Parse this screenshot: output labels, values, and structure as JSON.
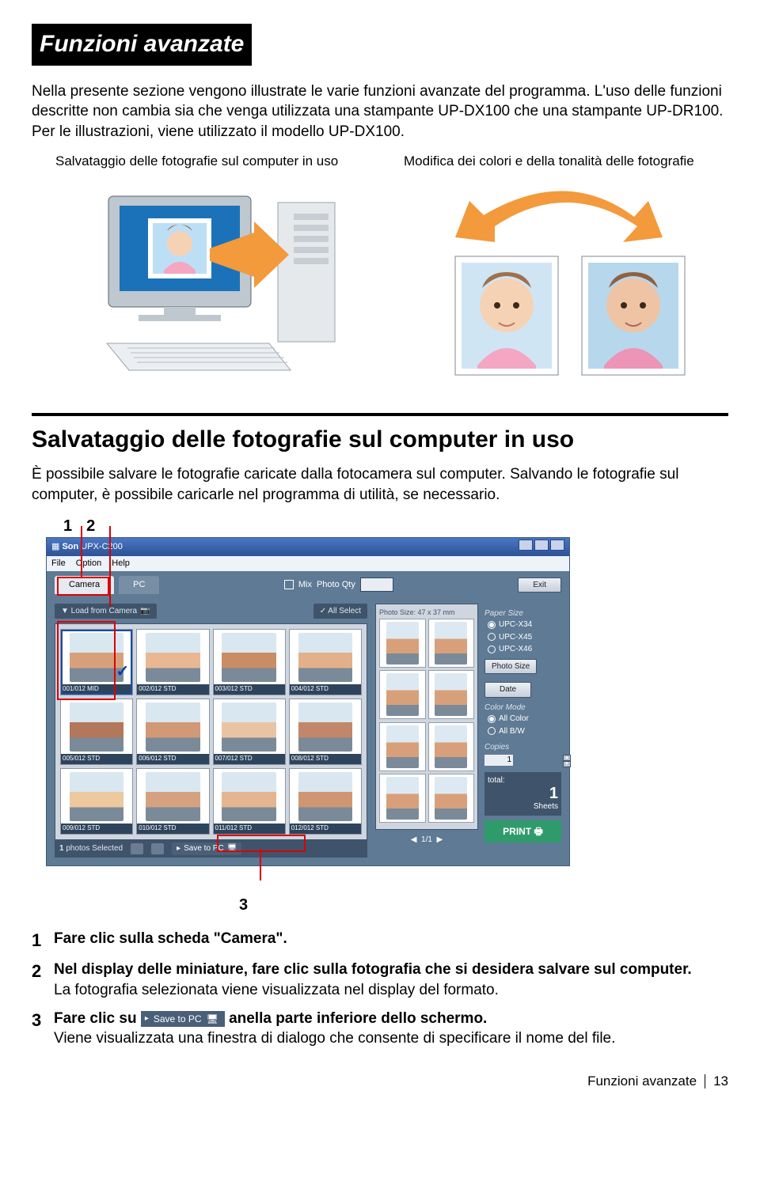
{
  "section_title": "Funzioni avanzate",
  "intro": "Nella presente sezione vengono illustrate le varie funzioni avanzate del programma. L'uso delle funzioni descritte non cambia sia che venga utilizzata una stampante UP-DX100 che una stampante UP-DR100. Per le illustrazioni, viene utilizzato il modello UP-DX100.",
  "col_left_caption": "Salvataggio delle fotografie sul computer in uso",
  "col_right_caption": "Modifica dei colori e della tonalità delle fotografie",
  "h2": "Salvataggio delle fotografie sul computer in uso",
  "body": "È possibile salvare le fotografie caricate dalla fotocamera sul computer. Salvando le fotografie sul computer, è possibile caricarle nel programma di utilità, se necessario.",
  "callouts": {
    "one": "1",
    "two": "2",
    "three": "3"
  },
  "app": {
    "title_prefix": "Son",
    "title_model": "UPX-C200",
    "menu": {
      "file": "File",
      "option": "Option",
      "help": "Help"
    },
    "tabs": {
      "camera": "Camera",
      "pc": "PC"
    },
    "mix_label": "Mix",
    "photo_qty_label": "Photo Qty",
    "exit": "Exit",
    "load_btn": "▼ Load from Camera",
    "all_select": "✓ All Select",
    "thumbs": [
      "001/012 MID",
      "002/012 STD",
      "003/012 STD",
      "004/012 STD",
      "005/012 STD",
      "006/012 STD",
      "007/012 STD",
      "008/012 STD",
      "009/012 STD",
      "010/012 STD",
      "011/012 STD",
      "012/012 STD"
    ],
    "selected_text": "photos Selected",
    "selected_count": "1",
    "save_to_pc": "Save to PC",
    "preview_title": "Photo Size: 47 x 37 mm",
    "pager": "1/1",
    "paper_size_label": "Paper Size",
    "paper_sizes": [
      "UPC-X34",
      "UPC-X45",
      "UPC-X46"
    ],
    "photo_size_btn": "Photo Size",
    "date_btn": "Date",
    "color_mode_label": "Color Mode",
    "color_all": "All Color",
    "color_bw": "All B/W",
    "copies_label": "Copies",
    "copies_val": "1",
    "total_label": "total:",
    "total_val": "1",
    "sheets_label": "Sheets",
    "print": "PRINT"
  },
  "inline_save_btn": "Save to PC",
  "steps": {
    "s1_lead": "Fare clic sulla scheda \"Camera\".",
    "s2_lead": "Nel display delle miniature, fare clic sulla fotografia che si desidera salvare sul computer.",
    "s2_body": "La fotografia selezionata viene visualizzata nel display del formato.",
    "s3_lead_a": "Fare clic su ",
    "s3_lead_b": " anella parte inferiore dello schermo.",
    "s3_body": "Viene visualizzata una finestra di dialogo che consente di specificare il nome del file."
  },
  "footer_label": "Funzioni avanzate",
  "page_no": "13",
  "face_colors": [
    "#d8a07a",
    "#e7b893",
    "#c98d66",
    "#e2b08a",
    "#b3775a",
    "#d19976",
    "#e8c4a5",
    "#c2876a",
    "#eec89f",
    "#d5a281",
    "#e4b590",
    "#cf9673"
  ]
}
